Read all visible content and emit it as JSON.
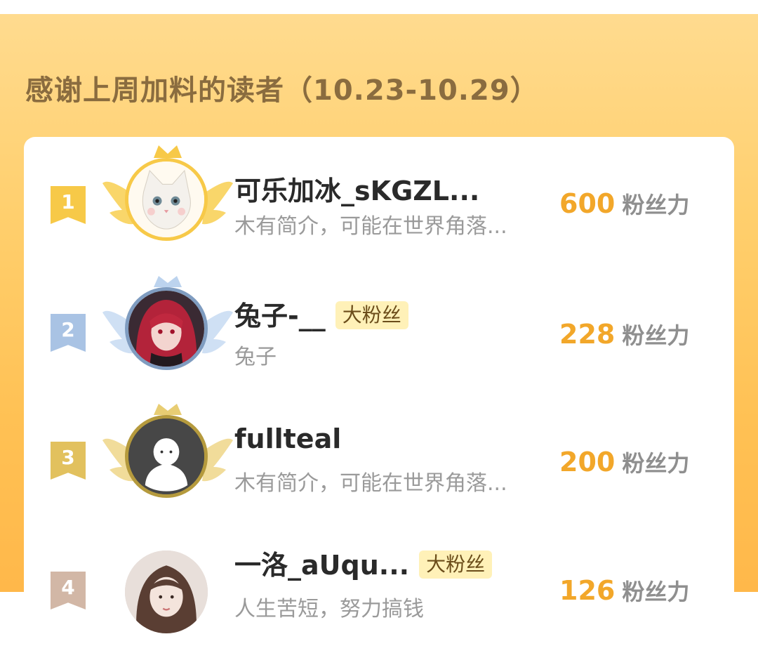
{
  "header": {
    "title": "感谢上周加料的读者（10.23-10.29）"
  },
  "colors": {
    "accent": "#f2a72a",
    "gold": "#f7c948",
    "silver": "#a9c3e4",
    "bronze": "#e2c15e",
    "badge_bg": "#fff1b8"
  },
  "ranking": [
    {
      "rank": "1",
      "name": "可乐加冰_sKGZL...",
      "badge": "",
      "bio": "木有简介，可能在世界角落...",
      "score": "600",
      "unit": "粉丝力",
      "avatar": "cat-avatar"
    },
    {
      "rank": "2",
      "name": "兔子-__",
      "badge": "大粉丝",
      "bio": "兔子",
      "score": "228",
      "unit": "粉丝力",
      "avatar": "anime-girl-avatar"
    },
    {
      "rank": "3",
      "name": "fullteal",
      "badge": "",
      "bio": "木有简介，可能在世界角落...",
      "score": "200",
      "unit": "粉丝力",
      "avatar": "default-user-avatar"
    },
    {
      "rank": "4",
      "name": "一洛_aUqu...",
      "badge": "大粉丝",
      "bio": "人生苦短，努力搞钱",
      "score": "126",
      "unit": "粉丝力",
      "avatar": "photo-avatar"
    }
  ]
}
